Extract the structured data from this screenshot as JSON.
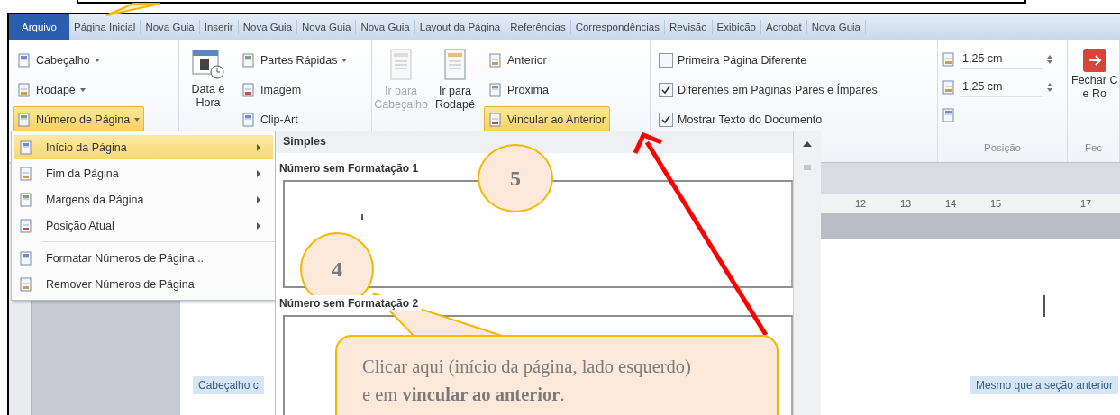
{
  "tabs": [
    {
      "label": "Arquivo",
      "kind": "file"
    },
    {
      "label": "Página Inicial",
      "kind": "tab"
    },
    {
      "label": "Nova Guia",
      "kind": "tab"
    },
    {
      "label": "Inserir",
      "kind": "tab"
    },
    {
      "label": "Nova Guia",
      "kind": "tab"
    },
    {
      "label": "Nova Guia",
      "kind": "tab"
    },
    {
      "label": "Nova Guia",
      "kind": "tab"
    },
    {
      "label": "Layout da Página",
      "kind": "tab"
    },
    {
      "label": "Referências",
      "kind": "tab"
    },
    {
      "label": "Correspondências",
      "kind": "tab"
    },
    {
      "label": "Revisão",
      "kind": "tab"
    },
    {
      "label": "Exibição",
      "kind": "tab"
    },
    {
      "label": "Acrobat",
      "kind": "tab"
    },
    {
      "label": "Nova Guia",
      "kind": "tab"
    }
  ],
  "ribbon": {
    "header_footer": [
      {
        "label": "Cabeçalho",
        "dropdown": true,
        "selected": false
      },
      {
        "label": "Rodapé",
        "dropdown": true,
        "selected": false
      },
      {
        "label": "Número de Página",
        "dropdown": true,
        "selected": true
      }
    ],
    "date_time": {
      "line1": "Data e",
      "line2": "Hora"
    },
    "insert_items": [
      {
        "label": "Partes Rápidas",
        "dropdown": true
      },
      {
        "label": "Imagem",
        "dropdown": false
      },
      {
        "label": "Clip-Art",
        "dropdown": false
      }
    ],
    "goto_buttons": [
      {
        "line1": "Ir para",
        "line2": "Cabeçalho",
        "disabled": true
      },
      {
        "line1": "Ir para",
        "line2": "Rodapé",
        "disabled": false
      }
    ],
    "nav_items": [
      {
        "label": "Anterior",
        "selected": false
      },
      {
        "label": "Próxima",
        "selected": false
      },
      {
        "label": "Vincular ao Anterior",
        "selected": true
      }
    ],
    "options": [
      {
        "label": "Primeira Página Diferente",
        "checked": false
      },
      {
        "label": "Diferentes em Páginas Pares e Ímpares",
        "checked": true
      },
      {
        "label": "Mostrar Texto do Documento",
        "checked": true
      }
    ],
    "position": {
      "spinners": [
        "1,25 cm",
        "1,25 cm"
      ],
      "group_label": "Posição"
    },
    "close": {
      "line1": "Fechar C",
      "line2": "e Ro",
      "group_label": "Fec"
    }
  },
  "page_number_menu": {
    "items": [
      {
        "label": "Início da Página",
        "kind": "submenu",
        "selected": true
      },
      {
        "label": "Fim da Página",
        "kind": "submenu",
        "selected": false
      },
      {
        "label": "Margens da Página",
        "kind": "submenu",
        "selected": false
      },
      {
        "label": "Posição Atual",
        "kind": "submenu",
        "selected": false
      },
      {
        "label": "Formatar Números de Página...",
        "kind": "action",
        "selected": false
      },
      {
        "label": "Remover Números de Página",
        "kind": "action",
        "selected": false
      }
    ]
  },
  "gallery": {
    "header": "Simples",
    "sections": [
      {
        "title": "Número sem Formatação 1"
      },
      {
        "title": "Número sem Formatação 2"
      }
    ]
  },
  "document": {
    "ruler": [
      "12",
      "13",
      "14",
      "15",
      "17"
    ],
    "left_tag": "Cabeçalho c",
    "right_tag": "Mesmo que a seção anterior"
  },
  "annotations": {
    "steps": [
      "5",
      "4"
    ],
    "callout": "Clicar aqui (início da página, lado esquerdo) e em **vincular ao anterior**."
  }
}
